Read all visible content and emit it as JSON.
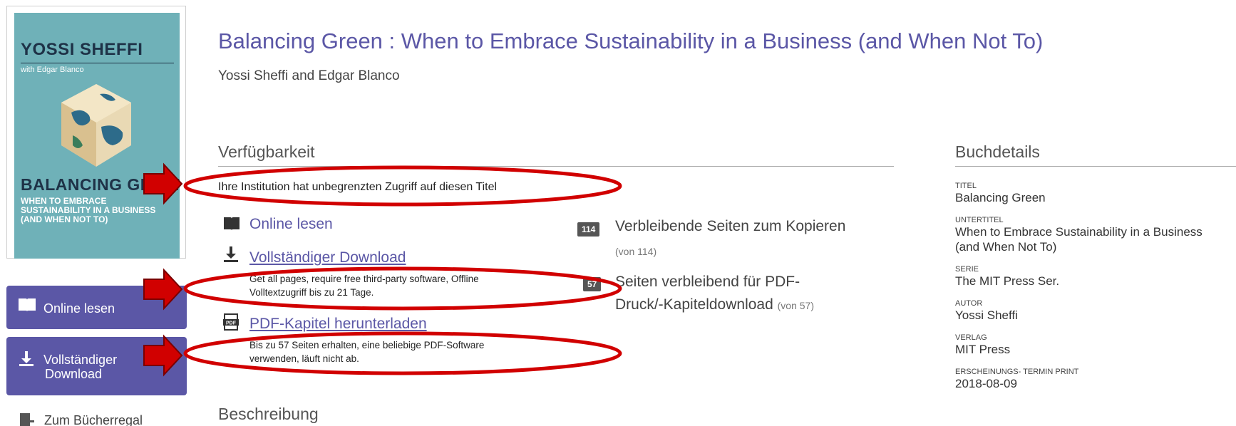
{
  "cover": {
    "author": "YOSSI SHEFFI",
    "with": "with Edgar Blanco",
    "title": "BALANCING GREEN",
    "subtitle_lines": [
      "WHEN TO EMBRACE",
      "SUSTAINABILITY IN A BUSINESS",
      "(AND WHEN NOT TO)"
    ]
  },
  "sidebar": {
    "online_label": "Online lesen",
    "download_label_1": "Vollständiger",
    "download_label_2": "Download",
    "shelf_label": "Zum Bücherregal"
  },
  "book": {
    "title": "Balancing Green : When to Embrace Sustainability in a Business (and When Not To)",
    "authors": "Yossi Sheffi and Edgar Blanco"
  },
  "availability": {
    "heading": "Verfügbarkeit",
    "access_text": "Ihre Institution hat unbegrenzten Zugriff auf diesen Titel",
    "online_link": "Online lesen",
    "download_link": "Vollständiger Download",
    "download_desc_1": "Get all pages, require free third-party software, Offline",
    "download_desc_2": "Volltextzugriff bis zu 21 Tage.",
    "pdf_link": "PDF-Kapitel herunterladen",
    "pdf_desc_1": "Bis zu 57 Seiten erhalten, eine beliebige PDF-Software",
    "pdf_desc_2": "verwenden, läuft nicht ab.",
    "copy_badge": "114",
    "copy_label": "Verbleibende Seiten zum Kopieren",
    "copy_of": "(von 114)",
    "print_badge": "57",
    "print_label_1": "Seiten verbleibend für PDF-",
    "print_label_2": "Druck/-Kapiteldownload",
    "print_of": "(von 57)"
  },
  "description": {
    "heading": "Beschreibung"
  },
  "details": {
    "heading": "Buchdetails",
    "title_label": "TITEL",
    "title_value": "Balancing Green",
    "subtitle_label": "UNTERTITEL",
    "subtitle_value_1": "When to Embrace Sustainability in a Business",
    "subtitle_value_2": "(and When Not To)",
    "series_label": "SERIE",
    "series_value": "The MIT Press Ser.",
    "author_label": "AUTOR",
    "author_value": "Yossi Sheffi",
    "publisher_label": "VERLAG",
    "publisher_value": "MIT Press",
    "date_label": "ERSCHEINUNGS- TERMIN PRINT",
    "date_value": "2018-08-09"
  },
  "colors": {
    "accent": "#5b57a6",
    "annotation": "#d10000",
    "cover_bg": "#6fb1b8"
  },
  "icons": [
    "book-icon",
    "download-icon",
    "pdf-icon",
    "bookshelf-icon",
    "red-arrow-icon"
  ]
}
